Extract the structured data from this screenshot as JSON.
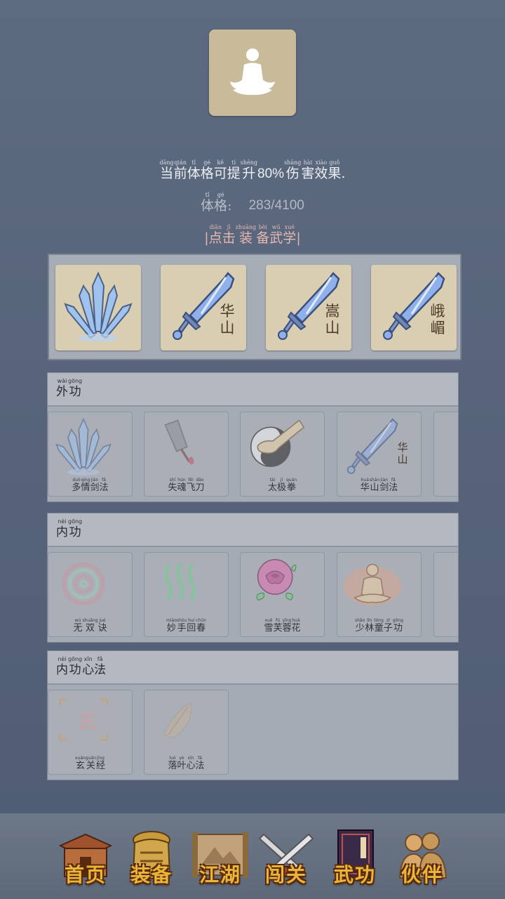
{
  "profile": {
    "effect_parts": [
      {
        "py": "dāng",
        "hz": "当"
      },
      {
        "py": "qián",
        "hz": "前"
      },
      {
        "py": "tǐ",
        "hz": "体"
      },
      {
        "py": "gé",
        "hz": "格"
      },
      {
        "py": "kě",
        "hz": "可"
      },
      {
        "py": "tí",
        "hz": "提"
      },
      {
        "py": "shēng",
        "hz": "升"
      }
    ],
    "effect_percent": "80%",
    "effect_tail": [
      {
        "py": "shāng",
        "hz": "伤"
      },
      {
        "py": "hài",
        "hz": "害"
      },
      {
        "py": "xiào",
        "hz": "效"
      },
      {
        "py": "guǒ",
        "hz": "果"
      }
    ],
    "effect_end": ".",
    "stat_label": [
      {
        "py": "tǐ",
        "hz": "体"
      },
      {
        "py": "gé",
        "hz": "格"
      }
    ],
    "stat_colon": ":",
    "stat_value": "283/4100",
    "hint_open": "|",
    "hint": [
      {
        "py": "diǎn",
        "hz": "点"
      },
      {
        "py": "jī",
        "hz": "击"
      },
      {
        "py": "zhuāng",
        "hz": "装"
      },
      {
        "py": "bèi",
        "hz": "备"
      },
      {
        "py": "wǔ",
        "hz": "武"
      },
      {
        "py": "xué",
        "hz": "学"
      }
    ],
    "hint_close": "|"
  },
  "equipped": [
    {
      "icon": "blade-fan-icon",
      "label": ""
    },
    {
      "icon": "sword-icon",
      "label": "华\n山"
    },
    {
      "icon": "sword-icon",
      "label": "嵩\n山"
    },
    {
      "icon": "sword-icon",
      "label": "峨\n嵋"
    }
  ],
  "sections": [
    {
      "title": [
        {
          "py": "wài",
          "hz": "外"
        },
        {
          "py": "gōng",
          "hz": "功"
        }
      ],
      "skills": [
        {
          "icon": "blade-fan-icon",
          "name": [
            {
              "py": "duō",
              "hz": "多"
            },
            {
              "py": "qíng",
              "hz": "情"
            },
            {
              "py": "jiàn",
              "hz": "剑"
            },
            {
              "py": "fǎ",
              "hz": "法"
            }
          ]
        },
        {
          "icon": "cleaver-icon",
          "name": [
            {
              "py": "shī",
              "hz": "失"
            },
            {
              "py": "hún",
              "hz": "魂"
            },
            {
              "py": "fēi",
              "hz": "飞"
            },
            {
              "py": "dāo",
              "hz": "刀"
            }
          ]
        },
        {
          "icon": "taiji-fist-icon",
          "name": [
            {
              "py": "tài",
              "hz": "太"
            },
            {
              "py": "jí",
              "hz": "极"
            },
            {
              "py": "quán",
              "hz": "拳"
            }
          ]
        },
        {
          "icon": "sword-icon",
          "name": [
            {
              "py": "huá",
              "hz": "华"
            },
            {
              "py": "shān",
              "hz": "山"
            },
            {
              "py": "jiàn",
              "hz": "剑"
            },
            {
              "py": "fǎ",
              "hz": "法"
            }
          ],
          "badge": "华\n山"
        }
      ]
    },
    {
      "title": [
        {
          "py": "nèi",
          "hz": "内"
        },
        {
          "py": "gōng",
          "hz": "功"
        }
      ],
      "skills": [
        {
          "icon": "spiral-icon",
          "name": [
            {
              "py": "wú",
              "hz": "无"
            },
            {
              "py": "shuāng",
              "hz": "双"
            },
            {
              "py": "jué",
              "hz": "诀"
            }
          ]
        },
        {
          "icon": "green-waves-icon",
          "name": [
            {
              "py": "miào",
              "hz": "妙"
            },
            {
              "py": "shǒu",
              "hz": "手"
            },
            {
              "py": "huí",
              "hz": "回"
            },
            {
              "py": "chūn",
              "hz": "春"
            }
          ]
        },
        {
          "icon": "rose-icon",
          "name": [
            {
              "py": "xuě",
              "hz": "雪"
            },
            {
              "py": "fú",
              "hz": "芙"
            },
            {
              "py": "yīng",
              "hz": "蓉"
            },
            {
              "py": "huā",
              "hz": "花"
            }
          ]
        },
        {
          "icon": "meditating-monk-icon",
          "name": [
            {
              "py": "shǎo",
              "hz": "少"
            },
            {
              "py": "lín",
              "hz": "林"
            },
            {
              "py": "tóng",
              "hz": "童"
            },
            {
              "py": "zǐ",
              "hz": "子"
            },
            {
              "py": "gōng",
              "hz": "功"
            }
          ]
        }
      ]
    },
    {
      "title": [
        {
          "py": "nèi",
          "hz": "内"
        },
        {
          "py": "gōng",
          "hz": "功"
        },
        {
          "py": "xīn",
          "hz": "心"
        },
        {
          "py": "fǎ",
          "hz": "法"
        }
      ],
      "skills": [
        {
          "icon": "xuan-glyph-icon",
          "name": [
            {
              "py": "xuán",
              "hz": "玄"
            },
            {
              "py": "guān",
              "hz": "关"
            },
            {
              "py": "jīng",
              "hz": "经"
            }
          ],
          "glyph": "玄"
        },
        {
          "icon": "leaf-icon",
          "name": [
            {
              "py": "luò",
              "hz": "落"
            },
            {
              "py": "yè",
              "hz": "叶"
            },
            {
              "py": "xīn",
              "hz": "心"
            },
            {
              "py": "fǎ",
              "hz": "法"
            }
          ]
        }
      ]
    }
  ],
  "nav": [
    {
      "key": "home",
      "label": "首页",
      "icon": "pavilion-icon"
    },
    {
      "key": "equipment",
      "label": "装备",
      "icon": "armor-icon"
    },
    {
      "key": "jianghu",
      "label": "江湖",
      "icon": "scroll-map-icon"
    },
    {
      "key": "challenge",
      "label": "闯关",
      "icon": "crossed-swords-icon"
    },
    {
      "key": "martial",
      "label": "武功",
      "icon": "manual-book-icon"
    },
    {
      "key": "partner",
      "label": "伙伴",
      "icon": "companions-icon"
    }
  ],
  "colors": {
    "accent": "#e9b53a",
    "hint": "#e7b8b0",
    "panel": "#a5abb5",
    "parchment": "#d9ceb1"
  }
}
